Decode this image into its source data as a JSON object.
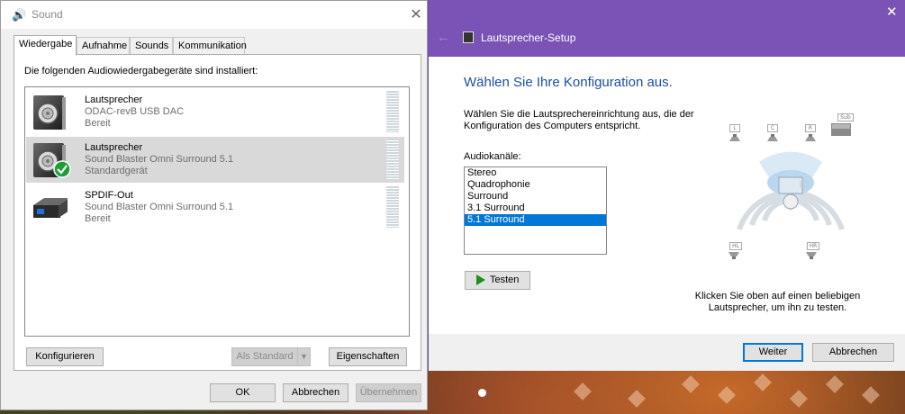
{
  "sound": {
    "title": "Sound",
    "tabs": [
      {
        "label": "Wiedergabe"
      },
      {
        "label": "Aufnahme"
      },
      {
        "label": "Sounds"
      },
      {
        "label": "Kommunikation"
      }
    ],
    "instruction": "Die folgenden Audiowiedergabegeräte sind installiert:",
    "devices": [
      {
        "name": "Lautsprecher",
        "line2": "ODAC-revB USB DAC",
        "line3": "Bereit",
        "icon": "speaker-icon"
      },
      {
        "name": "Lautsprecher",
        "line2": "Sound Blaster Omni Surround 5.1",
        "line3": "Standardgerät",
        "icon": "speaker-icon",
        "default_check": "checkmark-icon",
        "selected": true
      },
      {
        "name": "SPDIF-Out",
        "line2": "Sound Blaster Omni Surround 5.1",
        "line3": "Bereit",
        "icon": "spdif-device-icon"
      }
    ],
    "buttons": {
      "configure": "Konfigurieren",
      "set_default": "Als Standard",
      "properties": "Eigenschaften",
      "ok": "OK",
      "cancel": "Abbrechen",
      "apply": "Übernehmen"
    }
  },
  "setup": {
    "title": "Lautsprecher-Setup",
    "heading": "Wählen Sie Ihre Konfiguration aus.",
    "instruction": "Wählen Sie die Lautsprechereinrichtung aus, die der Konfiguration des Computers entspricht.",
    "channels_label": "Audiokanäle:",
    "channels": [
      "Stereo",
      "Quadrophonie",
      "Surround",
      "3.1 Surround",
      "5.1 Surround"
    ],
    "selected_channel": "5.1 Surround",
    "test_button": "Testen",
    "speaker_labels": {
      "left": "L",
      "center": "C",
      "right": "R",
      "sub": "Sub",
      "rear_left": "HL",
      "rear_right": "HR"
    },
    "hint": "Klicken Sie oben auf einen beliebigen Lautsprecher, um ihn zu testen.",
    "next_button": "Weiter",
    "cancel_button": "Abbrechen"
  },
  "colors": {
    "setup_titlebar": "#7b52b5",
    "heading_blue": "#1a4fa0",
    "selection_blue": "#0078d7",
    "check_green": "#1e9e3a"
  }
}
